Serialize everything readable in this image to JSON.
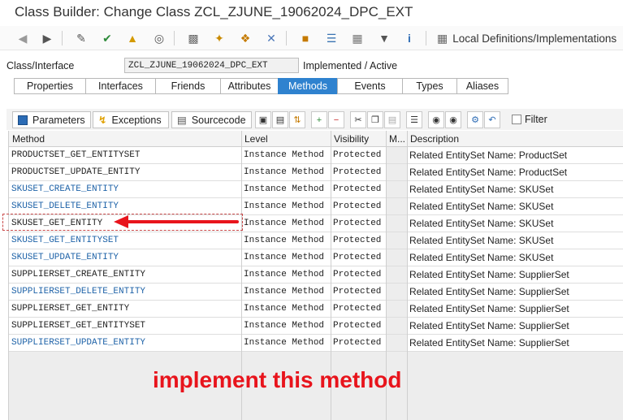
{
  "window": {
    "title": "Class Builder: Change Class ZCL_ZJUNE_19062024_DPC_EXT"
  },
  "toolbar": {
    "icons": [
      "back-icon",
      "forward-icon",
      "display-change-icon",
      "check-icon",
      "activate-icon",
      "where-used-icon",
      "object-list-icon",
      "magic-wand-icon",
      "pin-icon",
      "hierarchy-icon",
      "class-hierarchy-icon",
      "stack-icon",
      "table-icon",
      "filter-icon",
      "info-icon",
      "local-definitions-icon"
    ],
    "local_definitions_label": "Local Definitions/Implementations"
  },
  "class_row": {
    "label": "Class/Interface",
    "value": "ZCL_ZJUNE_19062024_DPC_EXT",
    "status": "Implemented / Active"
  },
  "tabs": [
    {
      "label": "Properties",
      "active": false
    },
    {
      "label": "Interfaces",
      "active": false
    },
    {
      "label": "Friends",
      "active": false
    },
    {
      "label": "Attributes",
      "active": false
    },
    {
      "label": "Methods",
      "active": true
    },
    {
      "label": "Events",
      "active": false
    },
    {
      "label": "Types",
      "active": false
    },
    {
      "label": "Aliases",
      "active": false
    }
  ],
  "subtoolbar": {
    "parameters_label": "Parameters",
    "exceptions_label": "Exceptions",
    "sourcecode_label": "Sourcecode",
    "filter_label": "Filter"
  },
  "grid": {
    "columns": [
      "Method",
      "Level",
      "Visibility",
      "M...",
      "Description"
    ],
    "rows": [
      {
        "method": "PRODUCTSET_GET_ENTITYSET",
        "level": "Instance Method",
        "visibility": "Protected",
        "description": "Related EntitySet Name: ProductSet",
        "link": false
      },
      {
        "method": "PRODUCTSET_UPDATE_ENTITY",
        "level": "Instance Method",
        "visibility": "Protected",
        "description": "Related EntitySet Name: ProductSet",
        "link": false
      },
      {
        "method": "SKUSET_CREATE_ENTITY",
        "level": "Instance Method",
        "visibility": "Protected",
        "description": "Related EntitySet Name: SKUSet",
        "link": true
      },
      {
        "method": "SKUSET_DELETE_ENTITY",
        "level": "Instance Method",
        "visibility": "Protected",
        "description": "Related EntitySet Name: SKUSet",
        "link": true
      },
      {
        "method": "SKUSET_GET_ENTITY",
        "level": "Instance Method",
        "visibility": "Protected",
        "description": "Related EntitySet Name: SKUSet",
        "link": false
      },
      {
        "method": "SKUSET_GET_ENTITYSET",
        "level": "Instance Method",
        "visibility": "Protected",
        "description": "Related EntitySet Name: SKUSet",
        "link": true
      },
      {
        "method": "SKUSET_UPDATE_ENTITY",
        "level": "Instance Method",
        "visibility": "Protected",
        "description": "Related EntitySet Name: SKUSet",
        "link": true
      },
      {
        "method": "SUPPLIERSET_CREATE_ENTITY",
        "level": "Instance Method",
        "visibility": "Protected",
        "description": "Related EntitySet Name: SupplierSet",
        "link": false
      },
      {
        "method": "SUPPLIERSET_DELETE_ENTITY",
        "level": "Instance Method",
        "visibility": "Protected",
        "description": "Related EntitySet Name: SupplierSet",
        "link": true
      },
      {
        "method": "SUPPLIERSET_GET_ENTITY",
        "level": "Instance Method",
        "visibility": "Protected",
        "description": "Related EntitySet Name: SupplierSet",
        "link": false
      },
      {
        "method": "SUPPLIERSET_GET_ENTITYSET",
        "level": "Instance Method",
        "visibility": "Protected",
        "description": "Related EntitySet Name: SupplierSet",
        "link": false
      },
      {
        "method": "SUPPLIERSET_UPDATE_ENTITY",
        "level": "Instance Method",
        "visibility": "Protected",
        "description": "Related EntitySet Name: SupplierSet",
        "link": true
      }
    ]
  },
  "annotation": {
    "text": "implement this method",
    "color": "#e8141c"
  },
  "colors": {
    "tab_active": "#2f82cf",
    "link": "#1f63a8"
  }
}
